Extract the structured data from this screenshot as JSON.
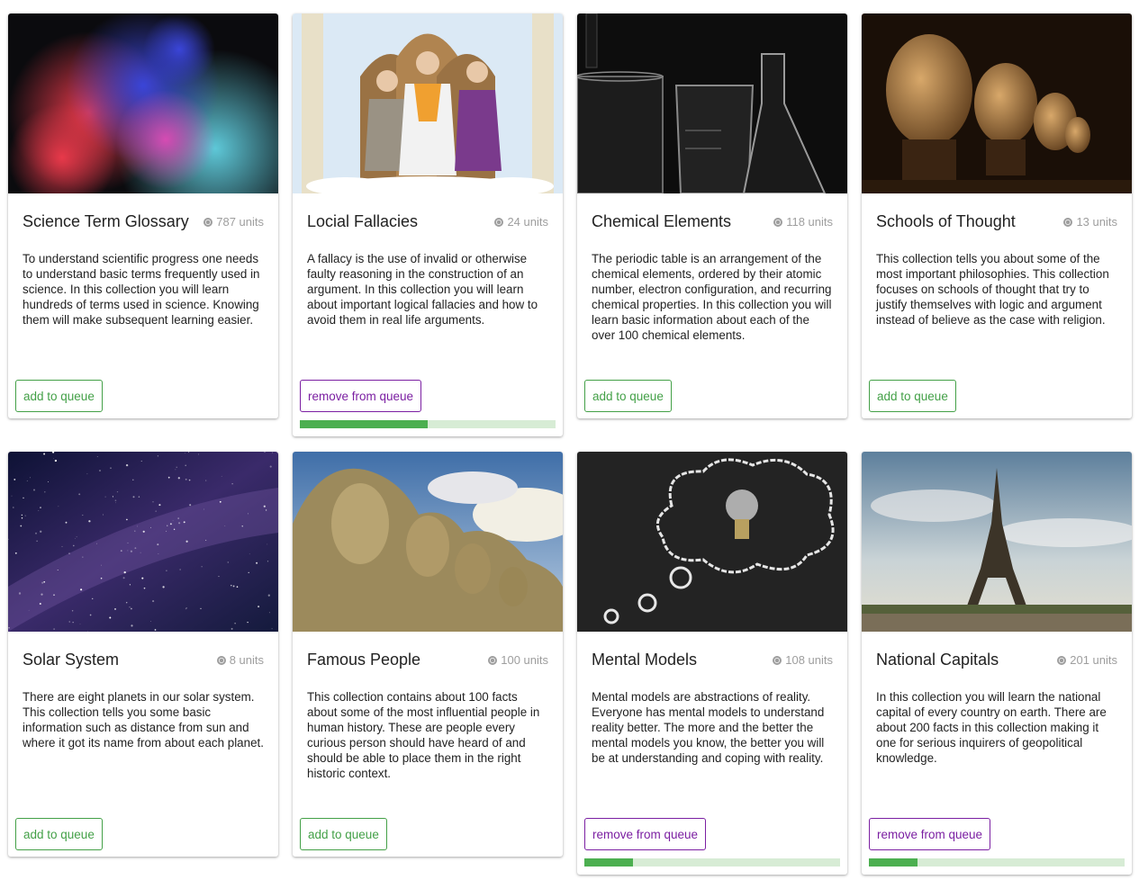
{
  "cards": [
    {
      "title": "Science Term Glossary",
      "units": "787 units",
      "description": "To understand scientific progress one needs to understand basic terms frequently used in science. In this collection you will learn hundreds of terms used in science. Knowing them will make subsequent learning easier.",
      "action": "add to queue",
      "image": "colored-smoke-image",
      "in_queue": false
    },
    {
      "title": "Locial Fallacies",
      "units": "24 units",
      "description": "A fallacy is the use of invalid or otherwise faulty reasoning in the construction of an argument. In this collection you will learn about important logical fallacies and how to avoid them in real life arguments.",
      "action": "remove from queue",
      "image": "philosophers-illustration-image",
      "in_queue": true,
      "progress": 0.5
    },
    {
      "title": "Chemical Elements",
      "units": "118 units",
      "description": "The periodic table is an arrangement of the chemical elements, ordered by their atomic number, electron configuration, and recurring chemical properties. In this collection you will learn basic information about each of the over 100 chemical elements.",
      "action": "add to queue",
      "image": "lab-glassware-image",
      "in_queue": false
    },
    {
      "title": "Schools of Thought",
      "units": "13 units",
      "description": "This collection tells you about some of the most important philosophies. This collection focuses on schools of thought that try to justify themselves with logic and argument instead of believe as the case with religion.",
      "action": "add to queue",
      "image": "philosopher-busts-image",
      "in_queue": false
    },
    {
      "title": "Solar System",
      "units": "8 units",
      "description": "There are eight planets in our solar system. This collection tells you some basic information such as distance from sun and where it got its name from about each planet.",
      "action": "add to queue",
      "image": "milky-way-image",
      "in_queue": false
    },
    {
      "title": "Famous People",
      "units": "100 units",
      "description": "This collection contains about 100 facts about some of the most influential people in human history. These are people every curious person should have heard of and should be able to place them in the right historic context.",
      "action": "add to queue",
      "image": "mount-rushmore-image",
      "in_queue": false
    },
    {
      "title": "Mental Models",
      "units": "108 units",
      "description": "Mental models are abstractions of reality. Everyone has mental models to understand reality better. The more and the better the mental models you know, the better you will be at understanding and coping with reality.",
      "action": "remove from queue",
      "image": "lightbulb-thought-bubble-image",
      "in_queue": true,
      "progress": 0.19
    },
    {
      "title": "National Capitals",
      "units": "201 units",
      "description": "In this collection you will learn the national capital of every country on earth. There are about 200 facts in this collection making it one for serious inquirers of geopolitical knowledge.",
      "action": "remove from queue",
      "image": "eiffel-tower-image",
      "in_queue": true,
      "progress": 0.19
    }
  ],
  "colors": {
    "add": "#43a047",
    "remove": "#7b1fa2",
    "progress_fill": "#4caf50",
    "progress_track": "#d7ecd5"
  }
}
